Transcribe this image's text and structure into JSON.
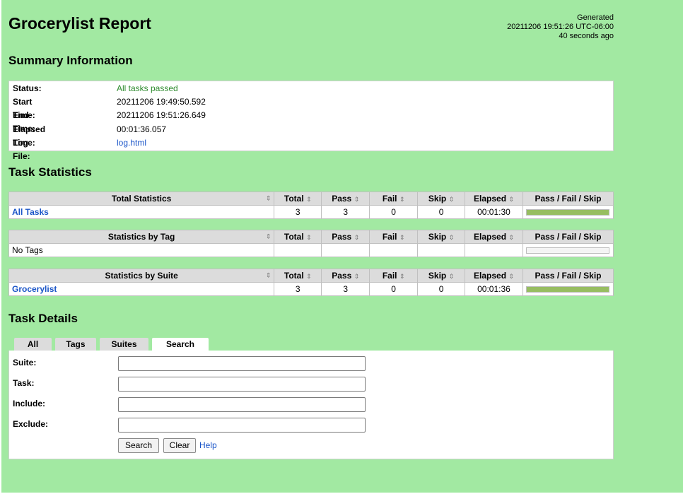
{
  "header": {
    "title": "Grocerylist Report",
    "generated_label": "Generated",
    "generated_timestamp": "20211206 19:51:26 UTC-06:00",
    "generated_ago": "40 seconds ago"
  },
  "summary": {
    "heading": "Summary Information",
    "status_label": "Status:",
    "status_value": "All tasks passed",
    "start_label": "Start Time:",
    "start_value": "20211206 19:49:50.592",
    "end_label": "End Time:",
    "end_value": "20211206 19:51:26.649",
    "elapsed_label": "Elapsed Time:",
    "elapsed_value": "00:01:36.057",
    "log_label": "Log File:",
    "log_value": "log.html"
  },
  "statistics": {
    "heading": "Task Statistics",
    "columns": {
      "total": "Total",
      "pass": "Pass",
      "fail": "Fail",
      "skip": "Skip",
      "elapsed": "Elapsed",
      "graph": "Pass / Fail / Skip"
    },
    "sort_icon": "⇕",
    "total_table": {
      "title": "Total Statistics",
      "row": {
        "name": "All Tasks",
        "total": "3",
        "pass": "3",
        "fail": "0",
        "skip": "0",
        "elapsed": "00:01:30",
        "pass_fraction": 1.0
      }
    },
    "tag_table": {
      "title": "Statistics by Tag",
      "row": {
        "name": "No Tags",
        "total": "",
        "pass": "",
        "fail": "",
        "skip": "",
        "elapsed": "",
        "pass_fraction": 0.0
      }
    },
    "suite_table": {
      "title": "Statistics by Suite",
      "row": {
        "name": "Grocerylist",
        "total": "3",
        "pass": "3",
        "fail": "0",
        "skip": "0",
        "elapsed": "00:01:36",
        "pass_fraction": 1.0
      }
    },
    "colors": {
      "pass_bar": "#97bd61",
      "header_bg": "#dcdcdc",
      "page_bg": "#a2e9a2",
      "link": "#1a55c8",
      "pass_text": "#2e8b2e"
    }
  },
  "details": {
    "heading": "Task Details",
    "tabs": [
      "All",
      "Tags",
      "Suites",
      "Search"
    ],
    "active_tab": "Search",
    "form": {
      "suite_label": "Suite:",
      "suite_value": "",
      "task_label": "Task:",
      "task_value": "",
      "include_label": "Include:",
      "include_value": "",
      "exclude_label": "Exclude:",
      "exclude_value": "",
      "search_button": "Search",
      "clear_button": "Clear",
      "help_link": "Help"
    }
  }
}
